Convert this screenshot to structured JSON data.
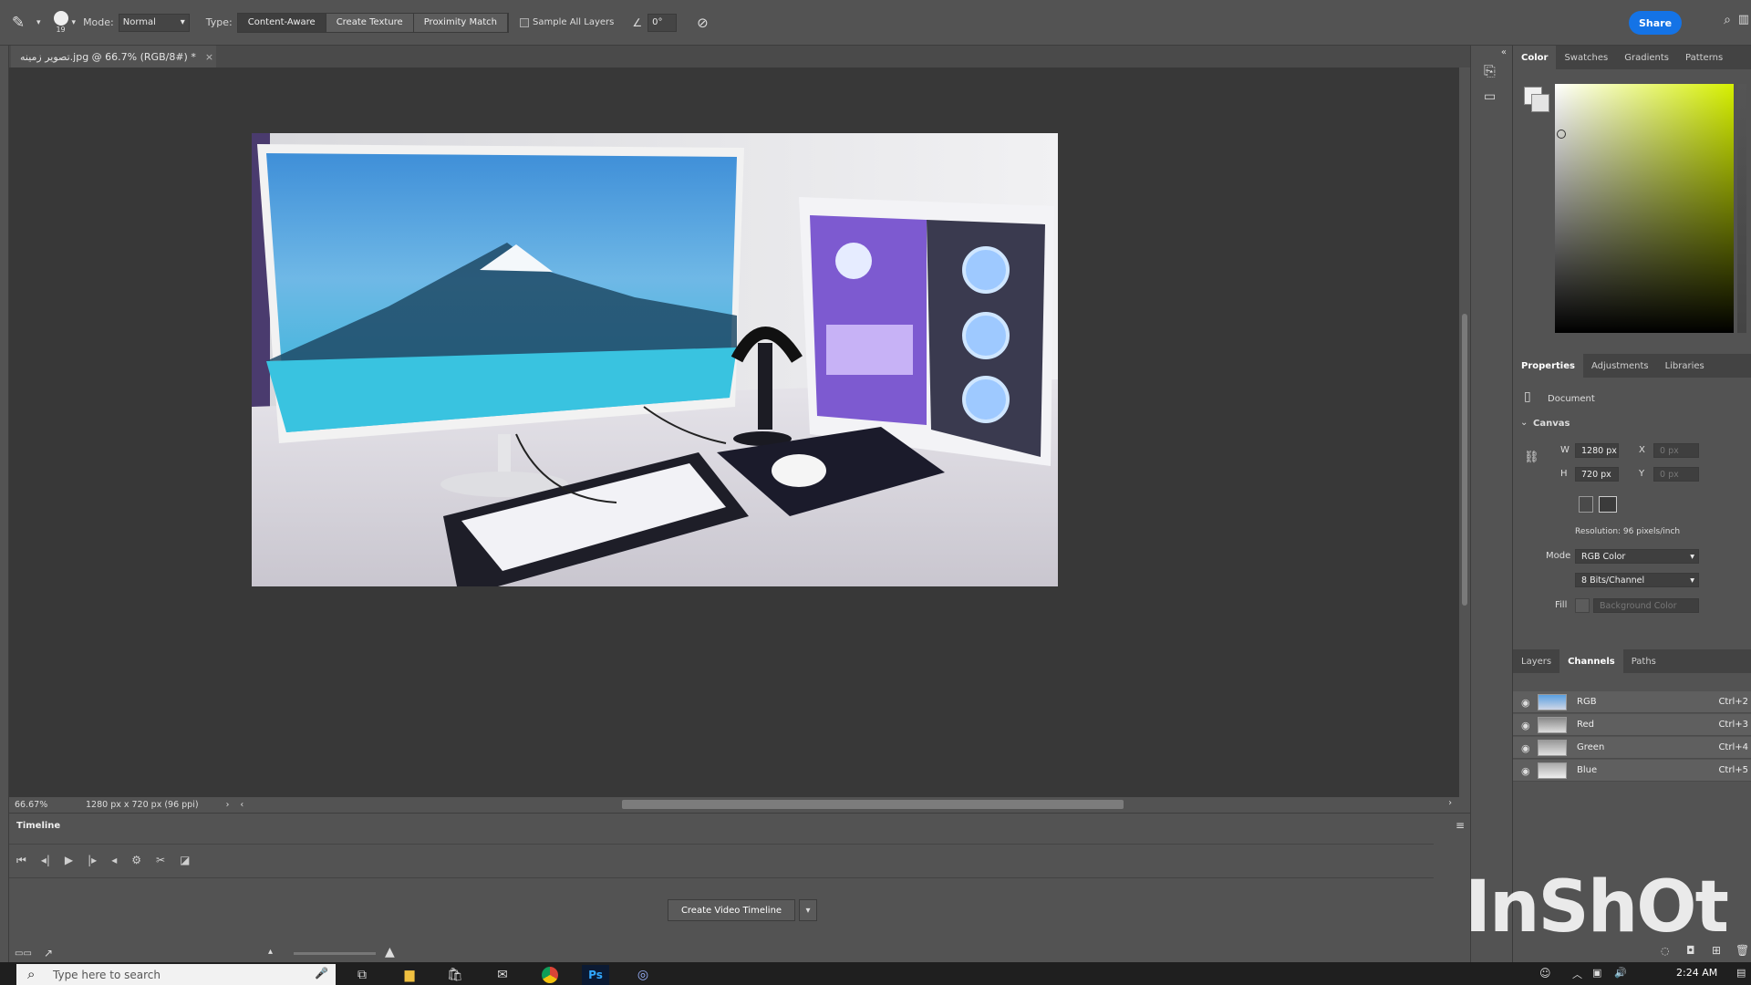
{
  "options_bar": {
    "brush_size": "19",
    "mode_label": "Mode:",
    "mode_value": "Normal",
    "type_label": "Type:",
    "type_options": [
      "Content-Aware",
      "Create Texture",
      "Proximity Match"
    ],
    "sample_all_layers": "Sample All Layers",
    "angle_value": "0°",
    "share_label": "Share"
  },
  "document": {
    "tab_title": "تصوير زمينه.jpg @ 66.7% (RGB/8#) *",
    "close_glyph": "×"
  },
  "status": {
    "zoom": "66.67%",
    "info": "1280 px x 720 px (96 ppi)"
  },
  "timeline": {
    "title": "Timeline",
    "create_button": "Create Video Timeline"
  },
  "color_panel": {
    "tabs": [
      "Color",
      "Swatches",
      "Gradients",
      "Patterns"
    ]
  },
  "properties_panel": {
    "tabs": [
      "Properties",
      "Adjustments",
      "Libraries"
    ],
    "section_document": "Document",
    "section_canvas": "Canvas",
    "w_label": "W",
    "w_value": "1280 px",
    "h_label": "H",
    "h_value": "720 px",
    "x_label": "X",
    "x_value": "0 px",
    "y_label": "Y",
    "y_value": "0 px",
    "resolution": "Resolution: 96 pixels/inch",
    "mode_label": "Mode",
    "mode_value": "RGB Color",
    "bits_value": "8 Bits/Channel",
    "fill_label": "Fill",
    "fill_value": "Background Color"
  },
  "layers_panel": {
    "tabs": [
      "Layers",
      "Channels",
      "Paths"
    ],
    "channels": [
      {
        "name": "RGB",
        "shortcut": "Ctrl+2"
      },
      {
        "name": "Red",
        "shortcut": "Ctrl+3"
      },
      {
        "name": "Green",
        "shortcut": "Ctrl+4"
      },
      {
        "name": "Blue",
        "shortcut": "Ctrl+5"
      }
    ]
  },
  "taskbar": {
    "search_placeholder": "Type here to search",
    "clock": "2:24 AM"
  },
  "watermark": "InShOt",
  "colors": {
    "share_blue": "#1473e6",
    "panel_bg": "#535353",
    "canvas_bg": "#383838"
  }
}
